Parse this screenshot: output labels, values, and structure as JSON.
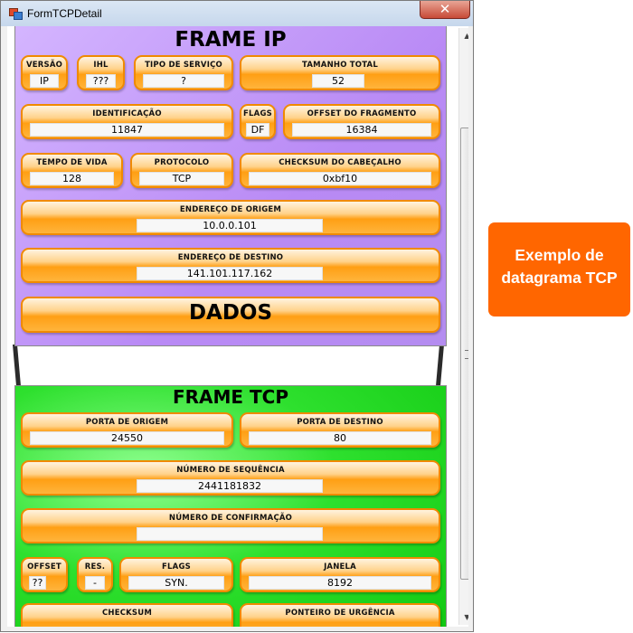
{
  "window": {
    "title": "FormTCPDetail",
    "close_glyph": "✕"
  },
  "ip_frame": {
    "title": "FRAME IP",
    "versao": {
      "label": "VERSÃO",
      "value": "IP"
    },
    "ihl": {
      "label": "IHL",
      "value": "???"
    },
    "tipo_servico": {
      "label": "TIPO DE SERVIÇO",
      "value": "?"
    },
    "tamanho_total": {
      "label": "TAMANHO TOTAL",
      "value": "52"
    },
    "identificacao": {
      "label": "IDENTIFICAÇÃO",
      "value": "11847"
    },
    "flags": {
      "label": "FLAGS",
      "value": "DF"
    },
    "offset_fragmento": {
      "label": "OFFSET DO FRAGMENTO",
      "value": "16384"
    },
    "tempo_vida": {
      "label": "TEMPO DE VIDA",
      "value": "128"
    },
    "protocolo": {
      "label": "PROTOCOLO",
      "value": "TCP"
    },
    "checksum_cabecalho": {
      "label": "CHECKSUM DO CABEÇALHO",
      "value": "0xbf10"
    },
    "endereco_origem": {
      "label": "ENDEREÇO DE ORIGEM",
      "value": "10.0.0.101"
    },
    "endereco_destino": {
      "label": "ENDEREÇO DE DESTINO",
      "value": "141.101.117.162"
    },
    "dados_label": "DADOS"
  },
  "tcp_frame": {
    "title": "FRAME TCP",
    "porta_origem": {
      "label": "PORTA DE ORIGEM",
      "value": "24550"
    },
    "porta_destino": {
      "label": "PORTA DE DESTINO",
      "value": "80"
    },
    "numero_sequencia": {
      "label": "NÚMERO DE SEQUÊNCIA",
      "value": "2441181832"
    },
    "numero_confirmacao": {
      "label": "NÚMERO DE CONFIRMAÇÃO",
      "value": ""
    },
    "offset": {
      "label": "OFFSET",
      "value": "??"
    },
    "reservado": {
      "label": "RES.",
      "value": "-"
    },
    "flags": {
      "label": "FLAGS",
      "value": "SYN."
    },
    "janela": {
      "label": "JANELA",
      "value": "8192"
    },
    "checksum": {
      "label": "CHECKSUM"
    },
    "ponteiro_urgencia": {
      "label": "PONTEIRO DE URGÊNCIA"
    }
  },
  "annotation": {
    "line1": "Exemplo de",
    "line2": "datagrama TCP"
  },
  "colors": {
    "ip_frame_bg": "#b98af5",
    "tcp_frame_bg": "#10c810",
    "field_orange": "#ff9f14",
    "annotation_bg": "#ff6600"
  },
  "scrollbar": {
    "up_icon": "scroll-up-arrow-icon",
    "down_icon": "scroll-down-arrow-icon"
  }
}
